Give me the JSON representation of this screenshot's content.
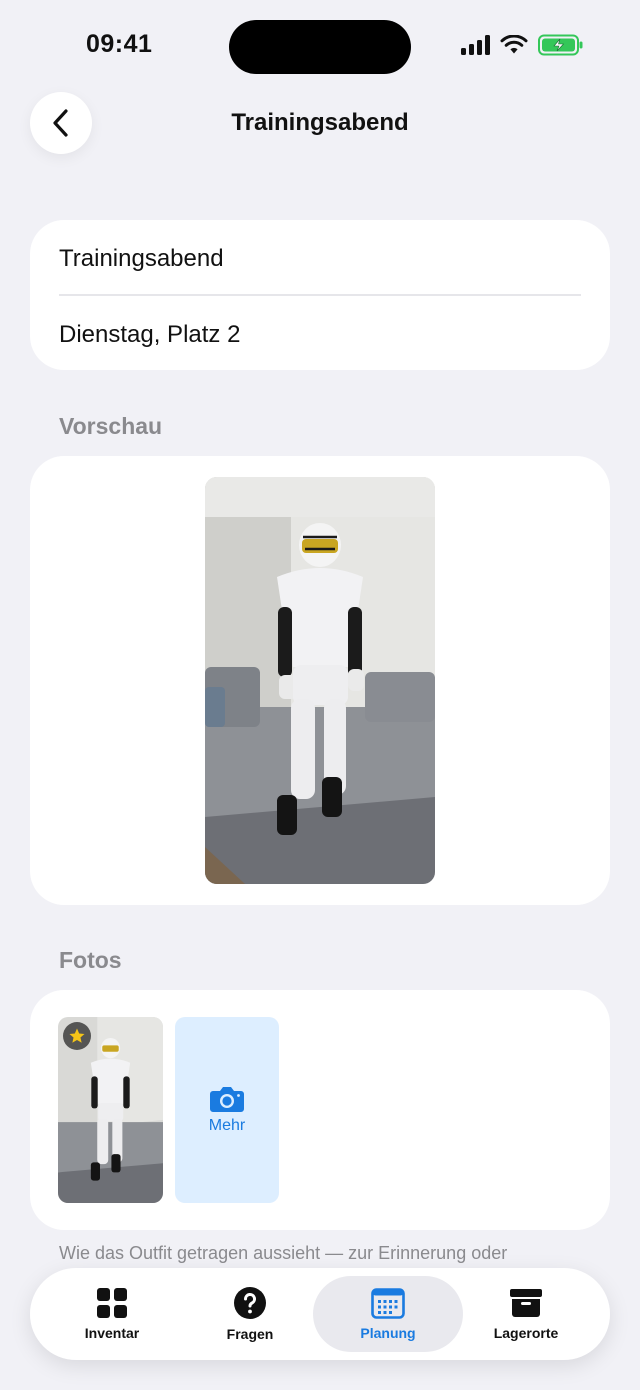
{
  "status_bar": {
    "time": "09:41"
  },
  "nav": {
    "title": "Trainingsabend"
  },
  "info": {
    "name": "Trainingsabend",
    "details": "Dienstag, Platz 2"
  },
  "sections": {
    "preview": "Vorschau",
    "photos": "Fotos"
  },
  "photos": {
    "more_label": "Mehr"
  },
  "footnote": "Wie das Outfit getragen aussieht — zur Erinnerung oder",
  "behind_text": "…",
  "tabbar": {
    "tabs": [
      {
        "label": "Inventar",
        "icon": "grid-icon"
      },
      {
        "label": "Fragen",
        "icon": "question-icon"
      },
      {
        "label": "Planung",
        "icon": "calendar-icon",
        "active": true
      },
      {
        "label": "Lagerorte",
        "icon": "archive-box-icon"
      }
    ]
  },
  "colors": {
    "accent": "#1A7BE0",
    "background": "#F1F1F6",
    "battery": "#34C759"
  }
}
